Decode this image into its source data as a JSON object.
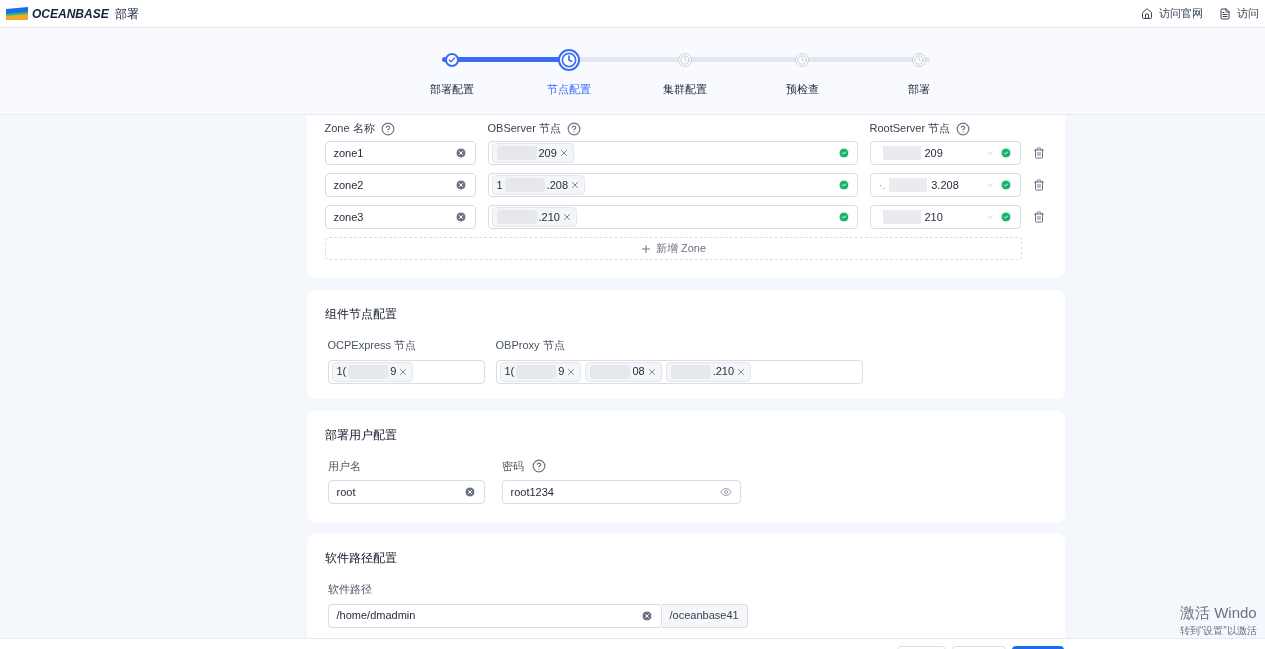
{
  "header": {
    "logo": "OCEANBASE",
    "title": "部署",
    "links": [
      {
        "kind": "home",
        "label": "访问官网"
      },
      {
        "kind": "doc",
        "label": "访问"
      }
    ]
  },
  "steps": [
    {
      "label": "部署配置",
      "done": true,
      "selected": false
    },
    {
      "label": "节点配置",
      "done": false,
      "selected": true
    },
    {
      "label": "集群配置",
      "done": false,
      "selected": false
    },
    {
      "label": "预检查",
      "done": false,
      "selected": false
    },
    {
      "label": "部署",
      "done": false,
      "selected": false
    }
  ],
  "zones": {
    "columns": [
      {
        "label": "Zone 名称",
        "help": true
      },
      {
        "label": "OBServer 节点",
        "help": true
      },
      {
        "label": "RootServer 节点",
        "help": true
      }
    ],
    "rows": [
      {
        "name": "zone1",
        "observers": [
          {
            "suffix": "209"
          }
        ],
        "root": "209",
        "valid": true
      },
      {
        "name": "zone2",
        "observers": [
          {
            "prefix": "1",
            "suffix": ".208"
          }
        ],
        "root_prefix": "·.",
        "root": "3.208",
        "valid": true
      },
      {
        "name": "zone3",
        "observers": [
          {
            "suffix": ".210"
          }
        ],
        "root": "210",
        "valid": true
      }
    ],
    "add_label": "新增 Zone"
  },
  "components": {
    "title": "组件节点配置",
    "fields": [
      {
        "label": "OCPExpress 节点",
        "tags": [
          {
            "prefix": "1(",
            "suffix": "9"
          }
        ]
      },
      {
        "label": "OBProxy 节点",
        "tags": [
          {
            "prefix": "1(",
            "suffix": "9"
          },
          {
            "suffix": "08"
          },
          {
            "suffix": ".210"
          }
        ]
      }
    ]
  },
  "user": {
    "title": "部署用户配置",
    "username_label": "用户名",
    "username": "root",
    "password_label": "密码",
    "password": "root1234"
  },
  "software": {
    "title": "软件路径配置",
    "path_label": "软件路径",
    "path": "/home/dmadmin",
    "suffix": "/oceanbase41"
  },
  "activation": {
    "line1": "激活 Windo",
    "line2": "转到“设置”以激活"
  }
}
